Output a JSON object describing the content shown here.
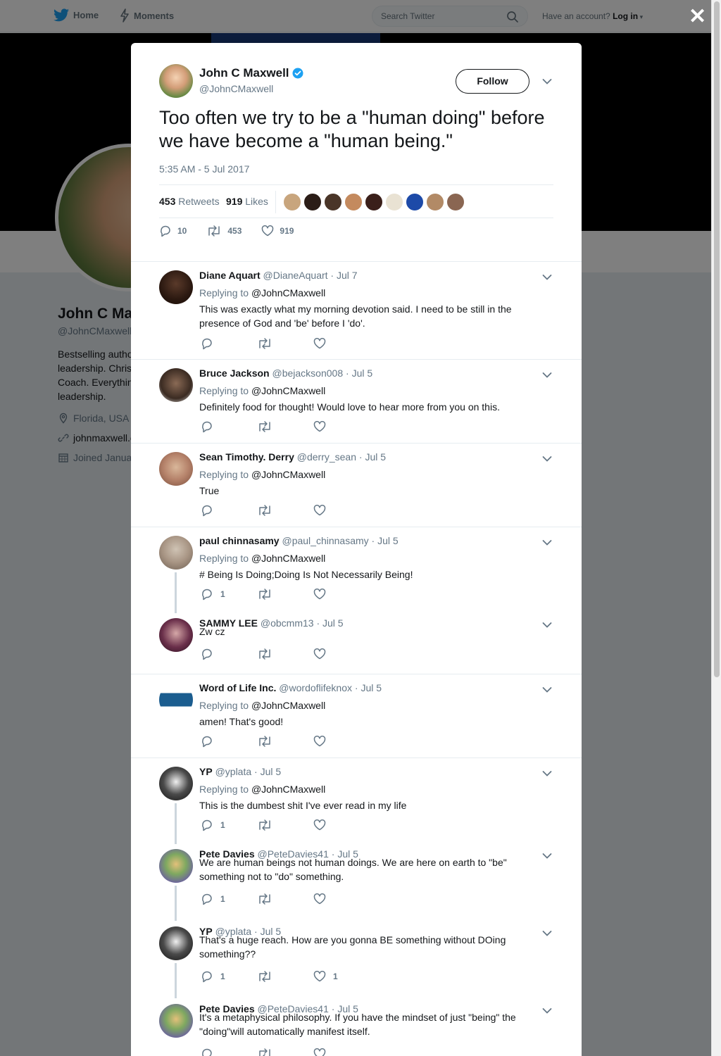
{
  "nav": {
    "home": "Home",
    "moments": "Moments",
    "search_placeholder": "Search Twitter",
    "account_prompt": "Have an account?",
    "login": "Log in"
  },
  "profile_bg": {
    "name": "John C Ma",
    "handle": "@JohnCMaxwell",
    "bio": "Bestselling autho\nleadership. Chris\nCoach. Everythin\nleadership.",
    "location": "Florida, USA",
    "website": "johnmaxwell.c",
    "joined": "Joined Janua"
  },
  "tweet": {
    "author_name": "John C Maxwell",
    "author_handle": "@JohnCMaxwell",
    "follow_label": "Follow",
    "text": "Too often we try to be a \"human doing\" before we have become a \"human being.\"",
    "time": "5:35 AM - 5 Jul 2017",
    "retweets_count": "453",
    "retweets_label": "Retweets",
    "likes_count": "919",
    "likes_label": "Likes",
    "replies_action": "10",
    "retweets_action": "453",
    "likes_action": "919"
  },
  "replies": [
    {
      "name": "Diane Aquart",
      "handle": "@DianeAquart",
      "date": "Jul 7",
      "replying": "Replying to",
      "to": "@JohnCMaxwell",
      "text": "This was exactly what my morning devotion said. I need to be still in the presence of God and 'be' before I 'do'.",
      "reply_count": "",
      "like_count": ""
    },
    {
      "name": "Bruce Jackson",
      "handle": "@bejackson008",
      "date": "Jul 5",
      "replying": "Replying to",
      "to": "@JohnCMaxwell",
      "text": "Definitely food for thought! Would love to hear more from you on this.",
      "reply_count": "",
      "like_count": ""
    },
    {
      "name": "Sean Timothy. Derry",
      "handle": "@derry_sean",
      "date": "Jul 5",
      "replying": "Replying to",
      "to": "@JohnCMaxwell",
      "text": "True",
      "reply_count": "",
      "like_count": ""
    },
    {
      "name": "paul chinnasamy",
      "handle": "@paul_chinnasamy",
      "date": "Jul 5",
      "replying": "Replying to",
      "to": "@JohnCMaxwell",
      "text": "# Being Is Doing;Doing Is Not Necessarily Being!",
      "reply_count": "1",
      "like_count": ""
    },
    {
      "name": "SAMMY LEE",
      "handle": "@obcmm13",
      "date": "Jul 5",
      "replying": "",
      "to": "",
      "text": "Zw cz",
      "reply_count": "",
      "like_count": ""
    },
    {
      "name": "Word of Life Inc.",
      "handle": "@wordoflifeknox",
      "date": "Jul 5",
      "replying": "Replying to",
      "to": "@JohnCMaxwell",
      "text": "amen! That's good!",
      "reply_count": "",
      "like_count": ""
    },
    {
      "name": "YP",
      "handle": "@yplata",
      "date": "Jul 5",
      "replying": "Replying to",
      "to": "@JohnCMaxwell",
      "text": "This is the dumbest shit I've ever read in my life",
      "reply_count": "1",
      "like_count": ""
    },
    {
      "name": "Pete Davies",
      "handle": "@PeteDavies41",
      "date": "Jul 5",
      "replying": "",
      "to": "",
      "text": "We are human beings not human doings. We are here on earth to \"be\" something not to \"do\" something.",
      "reply_count": "1",
      "like_count": ""
    },
    {
      "name": "YP",
      "handle": "@yplata",
      "date": "Jul 5",
      "replying": "",
      "to": "",
      "text": "That's a huge reach. How are you gonna BE something without DOing something??",
      "reply_count": "1",
      "like_count": "1"
    },
    {
      "name": "Pete Davies",
      "handle": "@PeteDavies41",
      "date": "Jul 5",
      "replying": "",
      "to": "",
      "text": "It's a metaphysical philosophy. If you have the mindset of just \"being\" the \"doing\"will automatically manifest itself.",
      "reply_count": "",
      "like_count": ""
    }
  ],
  "colors": {
    "accent": "#1da1f2",
    "muted": "#657786",
    "verified": "#1da1f2"
  }
}
